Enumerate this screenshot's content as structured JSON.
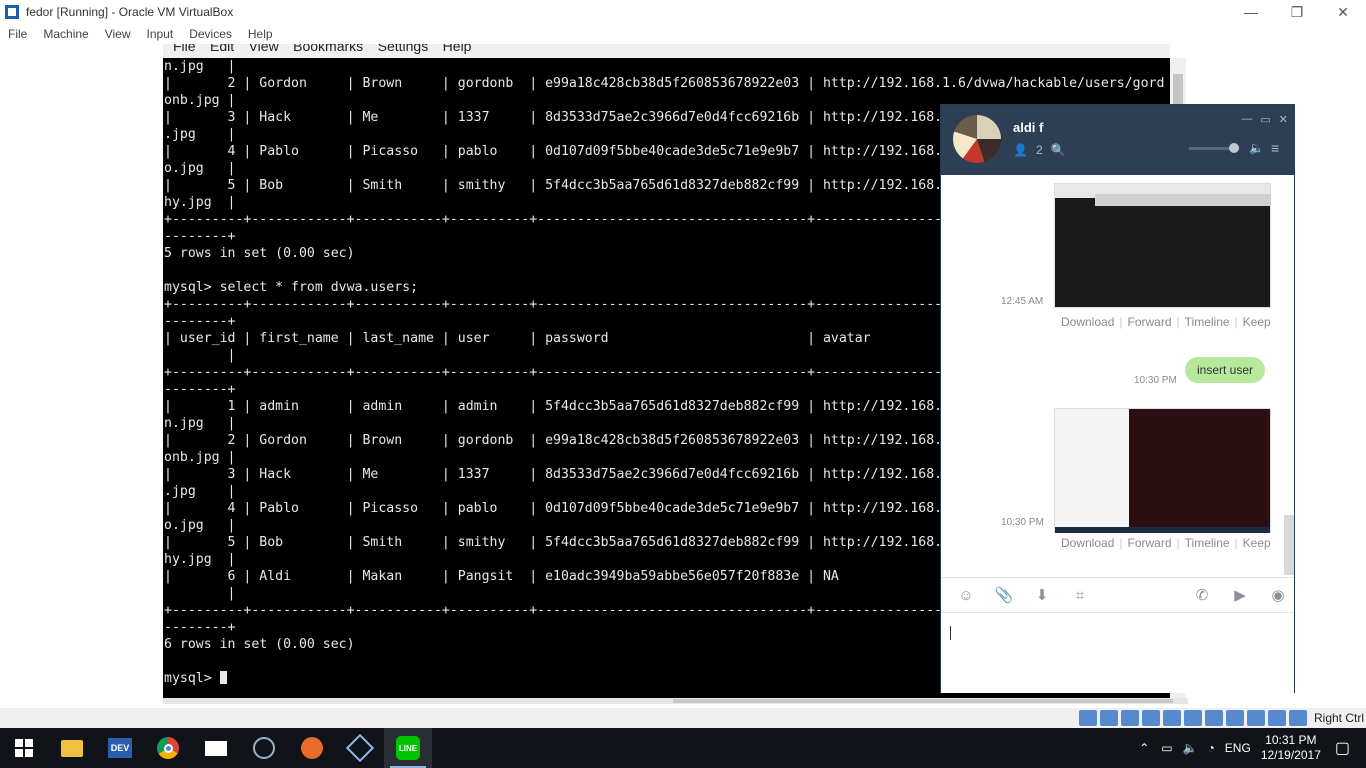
{
  "window": {
    "title": "fedor [Running] - Oracle VM VirtualBox",
    "controls": [
      "—",
      "❐",
      "✕"
    ]
  },
  "vbox_menu": [
    "File",
    "Machine",
    "View",
    "Input",
    "Devices",
    "Help"
  ],
  "guest_menu": [
    "File",
    "Edit",
    "View",
    "Bookmarks",
    "Settings",
    "Help"
  ],
  "terminal": {
    "lines": [
      "n.jpg   |",
      "|       2 | Gordon     | Brown     | gordonb  | e99a18c428cb38d5f260853678922e03 | http://192.168.1.6/dvwa/hackable/users/gord",
      "onb.jpg |",
      "|       3 | Hack       | Me        | 1337     | 8d3533d75ae2c3966d7e0d4fcc69216b | http://192.168.",
      ".jpg    |",
      "|       4 | Pablo      | Picasso   | pablo    | 0d107d09f5bbe40cade3de5c71e9e9b7 | http://192.168.",
      "o.jpg   |",
      "|       5 | Bob        | Smith     | smithy   | 5f4dcc3b5aa765d61d8327deb882cf99 | http://192.168.",
      "hy.jpg  |",
      "+---------+------------+-----------+----------+----------------------------------+----------------",
      "--------+",
      "5 rows in set (0.00 sec)",
      "",
      "mysql> select * from dvwa.users;",
      "+---------+------------+-----------+----------+----------------------------------+----------------",
      "--------+",
      "| user_id | first_name | last_name | user     | password                         | avatar",
      "        |",
      "+---------+------------+-----------+----------+----------------------------------+----------------",
      "--------+",
      "|       1 | admin      | admin     | admin    | 5f4dcc3b5aa765d61d8327deb882cf99 | http://192.168.",
      "n.jpg   |",
      "|       2 | Gordon     | Brown     | gordonb  | e99a18c428cb38d5f260853678922e03 | http://192.168.",
      "onb.jpg |",
      "|       3 | Hack       | Me        | 1337     | 8d3533d75ae2c3966d7e0d4fcc69216b | http://192.168.",
      ".jpg    |",
      "|       4 | Pablo      | Picasso   | pablo    | 0d107d09f5bbe40cade3de5c71e9e9b7 | http://192.168.",
      "o.jpg   |",
      "|       5 | Bob        | Smith     | smithy   | 5f4dcc3b5aa765d61d8327deb882cf99 | http://192.168.",
      "hy.jpg  |",
      "|       6 | Aldi       | Makan     | Pangsit  | e10adc3949ba59abbe56e057f20f883e | NA",
      "        |",
      "+---------+------------+-----------+----------+----------------------------------+----------------",
      "--------+",
      "6 rows in set (0.00 sec)",
      ""
    ],
    "prompt": "mysql> "
  },
  "line_chat": {
    "contact_name": "aldi f",
    "member_count": "2",
    "messages": {
      "img1_time": "12:45 AM",
      "text_time": "10:30 PM",
      "text": "insert user",
      "img2_time": "10:30 PM"
    },
    "image_actions": [
      "Download",
      "Forward",
      "Timeline",
      "Keep"
    ]
  },
  "statusbar": {
    "host_key": "Right Ctrl"
  },
  "taskbar": {
    "apps": [
      "windows-start",
      "file-explorer",
      "dev-cpp",
      "chrome",
      "mail",
      "network-app",
      "pen-tool",
      "virtualbox",
      "line"
    ],
    "language": "ENG",
    "time": "10:31 PM",
    "date": "12/19/2017"
  },
  "colors": {
    "terminal_bg": "#000000",
    "line_header": "#2d3f55",
    "bubble": "#b8e89c",
    "taskbar": "#101418"
  }
}
